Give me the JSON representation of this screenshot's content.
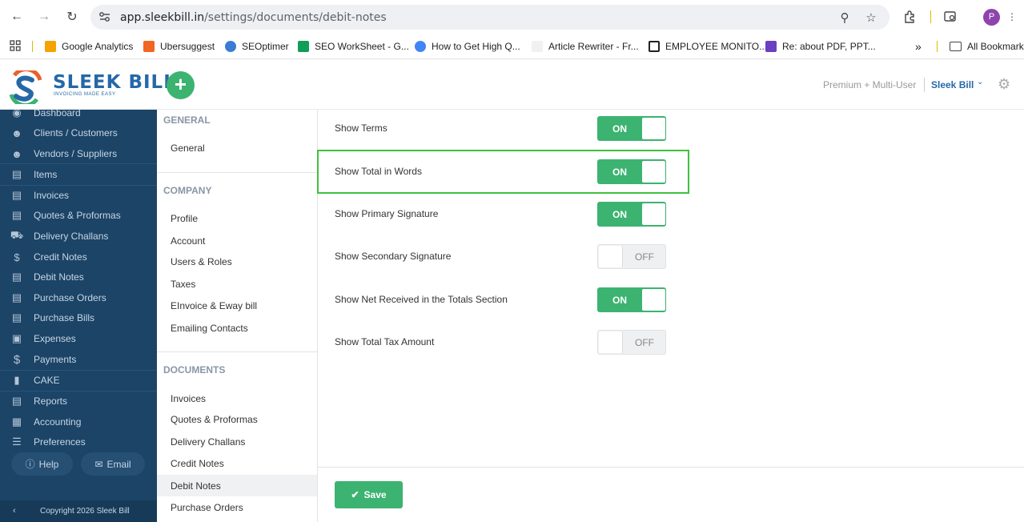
{
  "browser": {
    "url_host": "app.sleekbill.in",
    "url_path": "/settings/documents/debit-notes",
    "profile_initial": "P",
    "bookmarks": [
      {
        "label": "Google Analytics",
        "color": "#f4a300"
      },
      {
        "label": "Ubersuggest",
        "color": "#f26522"
      },
      {
        "label": "SEOptimer",
        "color": "#3a7bd5"
      },
      {
        "label": "SEO WorkSheet - G...",
        "color": "#0f9d58"
      },
      {
        "label": "How to Get High Q...",
        "color": "#4285f4"
      },
      {
        "label": "Article Rewriter - Fr...",
        "color": "#999999"
      },
      {
        "label": "EMPLOYEE MONITO...",
        "color": "#222222"
      },
      {
        "label": "Re: about PDF, PPT...",
        "color": "#6a3fc1"
      }
    ],
    "bookmarks_overflow": "»",
    "all_bookmarks": "All Bookmarks"
  },
  "header": {
    "logo_text": "SLEEK BILL",
    "logo_tagline": "INVOICING MADE EASY",
    "plan": "Premium + Multi-User",
    "account": "Sleek Bill"
  },
  "sidebar": {
    "items": [
      {
        "label": "Dashboard",
        "icon": "eye-icon"
      },
      {
        "label": "Clients / Customers",
        "icon": "users-icon"
      },
      {
        "label": "Vendors / Suppliers",
        "icon": "users-icon"
      },
      {
        "label": "Items",
        "icon": "basket-icon"
      },
      {
        "label": "Invoices",
        "icon": "document-icon"
      },
      {
        "label": "Quotes & Proformas",
        "icon": "document-icon"
      },
      {
        "label": "Delivery Challans",
        "icon": "truck-icon"
      },
      {
        "label": "Credit Notes",
        "icon": "dollar-box-icon"
      },
      {
        "label": "Debit Notes",
        "icon": "document-icon"
      },
      {
        "label": "Purchase Orders",
        "icon": "document-icon"
      },
      {
        "label": "Purchase Bills",
        "icon": "document-icon"
      },
      {
        "label": "Expenses",
        "icon": "wallet-icon"
      },
      {
        "label": "Payments",
        "icon": "dollar-icon"
      },
      {
        "label": "CAKE",
        "icon": "cake-icon"
      },
      {
        "label": "Reports",
        "icon": "report-icon"
      },
      {
        "label": "Accounting",
        "icon": "accounting-icon"
      },
      {
        "label": "Preferences",
        "icon": "sliders-icon"
      }
    ],
    "help": "Help",
    "email": "Email",
    "copyright": "Copyright 2026 Sleek Bill"
  },
  "settings_menu": {
    "general_heading": "GENERAL",
    "general_items": [
      "General"
    ],
    "company_heading": "COMPANY",
    "company_items": [
      "Profile",
      "Account",
      "Users & Roles",
      "Taxes",
      "EInvoice & Eway bill",
      "Emailing Contacts"
    ],
    "documents_heading": "DOCUMENTS",
    "documents_items": [
      "Invoices",
      "Quotes & Proformas",
      "Delivery Challans",
      "Credit Notes",
      "Debit Notes",
      "Purchase Orders"
    ],
    "active": "Debit Notes"
  },
  "settings": [
    {
      "label": "Show Terms",
      "state": "ON",
      "on": true
    },
    {
      "label": "Show Total in Words",
      "state": "ON",
      "on": true
    },
    {
      "label": "Show Primary Signature",
      "state": "ON",
      "on": true
    },
    {
      "label": "Show Secondary Signature",
      "state": "OFF",
      "on": false
    },
    {
      "label": "Show Net Received in the Totals Section",
      "state": "ON",
      "on": true
    },
    {
      "label": "Show Total Tax Amount",
      "state": "OFF",
      "on": false
    }
  ],
  "save_label": "Save",
  "colors": {
    "accent_green": "#3cb371",
    "sidebar": "#1b4467",
    "brand_blue": "#2568a8",
    "highlight": "#3ec23e"
  }
}
